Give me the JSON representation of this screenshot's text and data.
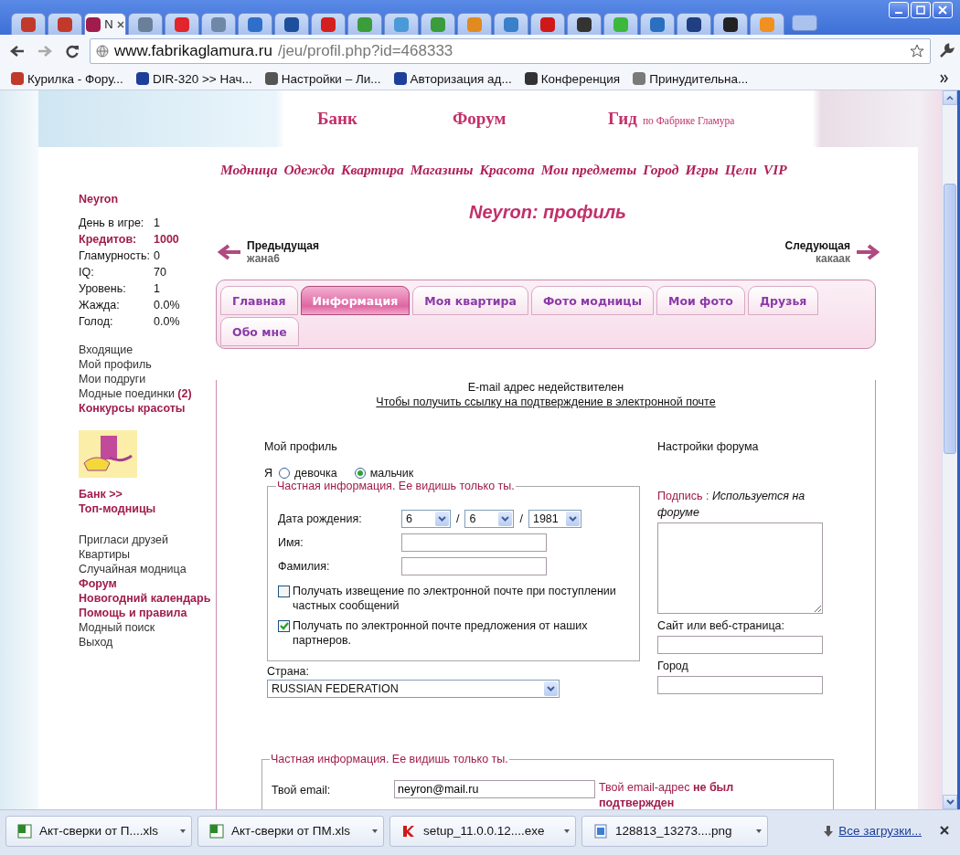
{
  "browser": {
    "tabs": [
      {
        "selected": false,
        "color": "#c0392b"
      },
      {
        "selected": false,
        "color": "#c0392b"
      },
      {
        "title": "N",
        "selected": true,
        "color": "#a01c4c"
      },
      {
        "selected": false,
        "color": "#6a7f98"
      },
      {
        "selected": false,
        "color": "#e0262c"
      },
      {
        "selected": false,
        "color": "#6f88a8"
      },
      {
        "selected": false,
        "color": "#2f6fc9"
      },
      {
        "selected": false,
        "color": "#1d4f9a"
      },
      {
        "selected": false,
        "color": "#d41f1f"
      },
      {
        "selected": false,
        "color": "#3a9c3a"
      },
      {
        "selected": false,
        "color": "#4a9ad8"
      },
      {
        "selected": false,
        "color": "#3a9c3a"
      },
      {
        "selected": false,
        "color": "#e08a20"
      },
      {
        "selected": false,
        "color": "#3a7fc9"
      },
      {
        "selected": false,
        "color": "#d01818"
      },
      {
        "selected": false,
        "color": "#333333"
      },
      {
        "selected": false,
        "color": "#3cb83c"
      },
      {
        "selected": false,
        "color": "#2a6fc0"
      },
      {
        "selected": false,
        "color": "#1f3f80"
      },
      {
        "selected": false,
        "color": "#222222"
      },
      {
        "selected": false,
        "color": "#f09020"
      }
    ],
    "address_host": "www.fabrikaglamura.ru",
    "address_path": "/jeu/profil.php?id=468333",
    "bookmarks": [
      {
        "label": "Курилка - Фору...",
        "color": "#c0392b"
      },
      {
        "label": "DIR-320 >> Нач...",
        "color": "#1d3f9a"
      },
      {
        "label": "Настройки – Ли...",
        "color": "#555555"
      },
      {
        "label": "Авторизация ад...",
        "color": "#1d3f9a"
      },
      {
        "label": "Конференция",
        "color": "#333333"
      },
      {
        "label": "Принудительна...",
        "color": "#7a7a7a"
      }
    ]
  },
  "header": {
    "links": [
      "Банк",
      "Форум",
      "Гид"
    ],
    "guide_note": "по Фабрике Гламура"
  },
  "nav": [
    "Модница",
    "Одежда",
    "Квартира",
    "Магазины",
    "Красота",
    "Мои предметы",
    "Город",
    "Игры",
    "Цели",
    "VIP"
  ],
  "sidebar": {
    "user": "Neyron",
    "stats": [
      {
        "label": "День в игре:",
        "value": "1",
        "highlight": false
      },
      {
        "label": "Кредитов:",
        "value": "1000",
        "highlight": true
      },
      {
        "label": "Гламурность:",
        "value": "0",
        "highlight": false
      },
      {
        "label": "IQ:",
        "value": "70",
        "highlight": false
      },
      {
        "label": "Уровень:",
        "value": "1",
        "highlight": false
      },
      {
        "label": "Жажда:",
        "value": "0.0%",
        "highlight": false
      },
      {
        "label": "Голод:",
        "value": "0.0%",
        "highlight": false
      }
    ],
    "links_1": [
      {
        "label": "Входящие",
        "bold": false
      },
      {
        "label": "Мой профиль",
        "bold": false
      },
      {
        "label": "Мои подруги",
        "bold": false
      },
      {
        "label": "Модные поединки **(2)**",
        "bold": false
      },
      {
        "label": "Конкурсы красоты",
        "bold": true
      }
    ],
    "links_2": [
      {
        "label": "Банк >>",
        "bold": true
      },
      {
        "label": "Топ-модницы",
        "bold": true
      }
    ],
    "links_3": [
      {
        "label": "Пригласи друзей",
        "bold": false
      },
      {
        "label": "Квартиры",
        "bold": false
      },
      {
        "label": "Случайная модница",
        "bold": false
      },
      {
        "label": "Форум",
        "bold": true
      },
      {
        "label": "Новогодний календарь",
        "bold": true
      },
      {
        "label": "Помощь и правила",
        "bold": true
      },
      {
        "label": "Модный поиск",
        "bold": false
      },
      {
        "label": "Выход",
        "bold": false
      }
    ]
  },
  "profile_title": "Neyron: профиль",
  "prev": {
    "label": "Предыдущая",
    "name": "жана6"
  },
  "next": {
    "label": "Следующая",
    "name": "какаак"
  },
  "tabs": [
    {
      "label": "Главная",
      "selected": false
    },
    {
      "label": "Информация",
      "selected": true
    },
    {
      "label": "Моя квартира",
      "selected": false
    },
    {
      "label": "Фото модницы",
      "selected": false
    },
    {
      "label": "Мои фото",
      "selected": false
    },
    {
      "label": "Друзья",
      "selected": false
    },
    {
      "label": "Обо мне",
      "selected": false
    }
  ],
  "notice": {
    "text": "E-mail адрес недействителен",
    "link": "Чтобы получить ссылку на подтверждение в электронной почте"
  },
  "my_profile": {
    "heading": "Мой профиль",
    "gender_label": "Я",
    "gender": [
      {
        "label": "девочка",
        "selected": false
      },
      {
        "label": "мальчик",
        "selected": true
      }
    ],
    "legend": "Частная информация. Ее видишь только ты.",
    "birth_label": "Дата рождения:",
    "birth": [
      "6",
      "6",
      "1981"
    ],
    "separator": "/",
    "fields": [
      {
        "label": "Имя:"
      },
      {
        "label": "Фамилия:"
      }
    ],
    "checkboxes": [
      {
        "label": "Получать извещение по электронной почте при поступлении частных сообщений",
        "checked": false
      },
      {
        "label": "Получать по электронной почте предложения от наших партнеров.",
        "checked": true
      }
    ],
    "country_label": "Страна:",
    "country": "RUSSIAN FEDERATION"
  },
  "forum": {
    "heading": "Настройки форума",
    "signature_label": "Подпись :",
    "signature_note": "Используется на форуме",
    "site_label": "Сайт или веб-страница:",
    "city_label": "Город"
  },
  "private": {
    "legend": "Частная информация. Ее видишь только ты.",
    "email_label": "Твой email:",
    "email": "neyron@mail.ru",
    "warning": "Твой email-адрес **не был подтвержден**"
  },
  "downloads": {
    "items": [
      {
        "name": "Акт-сверки от П....xls",
        "kind": "xls"
      },
      {
        "name": "Акт-сверки от ПМ.xls",
        "kind": "xls"
      },
      {
        "name": "setup_11.0.0.12....exe",
        "kind": "exe"
      },
      {
        "name": "128813_13273....png",
        "kind": "png"
      }
    ],
    "all": "Все загрузки..."
  }
}
